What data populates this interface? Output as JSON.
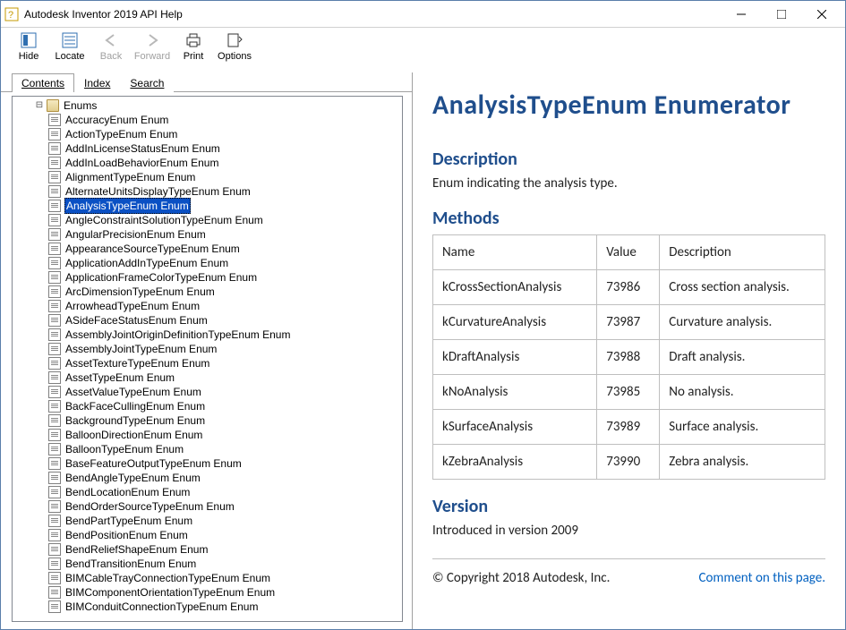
{
  "window": {
    "title": "Autodesk Inventor 2019 API Help"
  },
  "toolbar": {
    "hide": "Hide",
    "locate": "Locate",
    "back": "Back",
    "forward": "Forward",
    "print": "Print",
    "options": "Options"
  },
  "tabs": {
    "contents": "Contents",
    "index": "Index",
    "search": "Search"
  },
  "tree": {
    "root": "Enums",
    "items": [
      "AccuracyEnum Enum",
      "ActionTypeEnum Enum",
      "AddInLicenseStatusEnum Enum",
      "AddInLoadBehaviorEnum Enum",
      "AlignmentTypeEnum Enum",
      "AlternateUnitsDisplayTypeEnum Enum",
      "AnalysisTypeEnum Enum",
      "AngleConstraintSolutionTypeEnum Enum",
      "AngularPrecisionEnum Enum",
      "AppearanceSourceTypeEnum Enum",
      "ApplicationAddInTypeEnum Enum",
      "ApplicationFrameColorTypeEnum Enum",
      "ArcDimensionTypeEnum Enum",
      "ArrowheadTypeEnum Enum",
      "ASideFaceStatusEnum Enum",
      "AssemblyJointOriginDefinitionTypeEnum Enum",
      "AssemblyJointTypeEnum Enum",
      "AssetTextureTypeEnum Enum",
      "AssetTypeEnum Enum",
      "AssetValueTypeEnum Enum",
      "BackFaceCullingEnum Enum",
      "BackgroundTypeEnum Enum",
      "BalloonDirectionEnum Enum",
      "BalloonTypeEnum Enum",
      "BaseFeatureOutputTypeEnum Enum",
      "BendAngleTypeEnum Enum",
      "BendLocationEnum Enum",
      "BendOrderSourceTypeEnum Enum",
      "BendPartTypeEnum Enum",
      "BendPositionEnum Enum",
      "BendReliefShapeEnum Enum",
      "BendTransitionEnum Enum",
      "BIMCableTrayConnectionTypeEnum Enum",
      "BIMComponentOrientationTypeEnum Enum",
      "BIMConduitConnectionTypeEnum Enum"
    ],
    "selectedIndex": 6
  },
  "page": {
    "title": "AnalysisTypeEnum Enumerator",
    "desc_h": "Description",
    "desc": "Enum indicating the analysis type.",
    "methods_h": "Methods",
    "cols": {
      "name": "Name",
      "value": "Value",
      "description": "Description"
    },
    "rows": [
      {
        "name": "kCrossSectionAnalysis",
        "value": "73986",
        "description": "Cross section analysis."
      },
      {
        "name": "kCurvatureAnalysis",
        "value": "73987",
        "description": "Curvature analysis."
      },
      {
        "name": "kDraftAnalysis",
        "value": "73988",
        "description": "Draft analysis."
      },
      {
        "name": "kNoAnalysis",
        "value": "73985",
        "description": "No analysis."
      },
      {
        "name": "kSurfaceAnalysis",
        "value": "73989",
        "description": "Surface analysis."
      },
      {
        "name": "kZebraAnalysis",
        "value": "73990",
        "description": "Zebra analysis."
      }
    ],
    "version_h": "Version",
    "version": "Introduced in version 2009",
    "copyright": "© Copyright 2018 Autodesk, Inc.",
    "comment": "Comment on this page."
  }
}
